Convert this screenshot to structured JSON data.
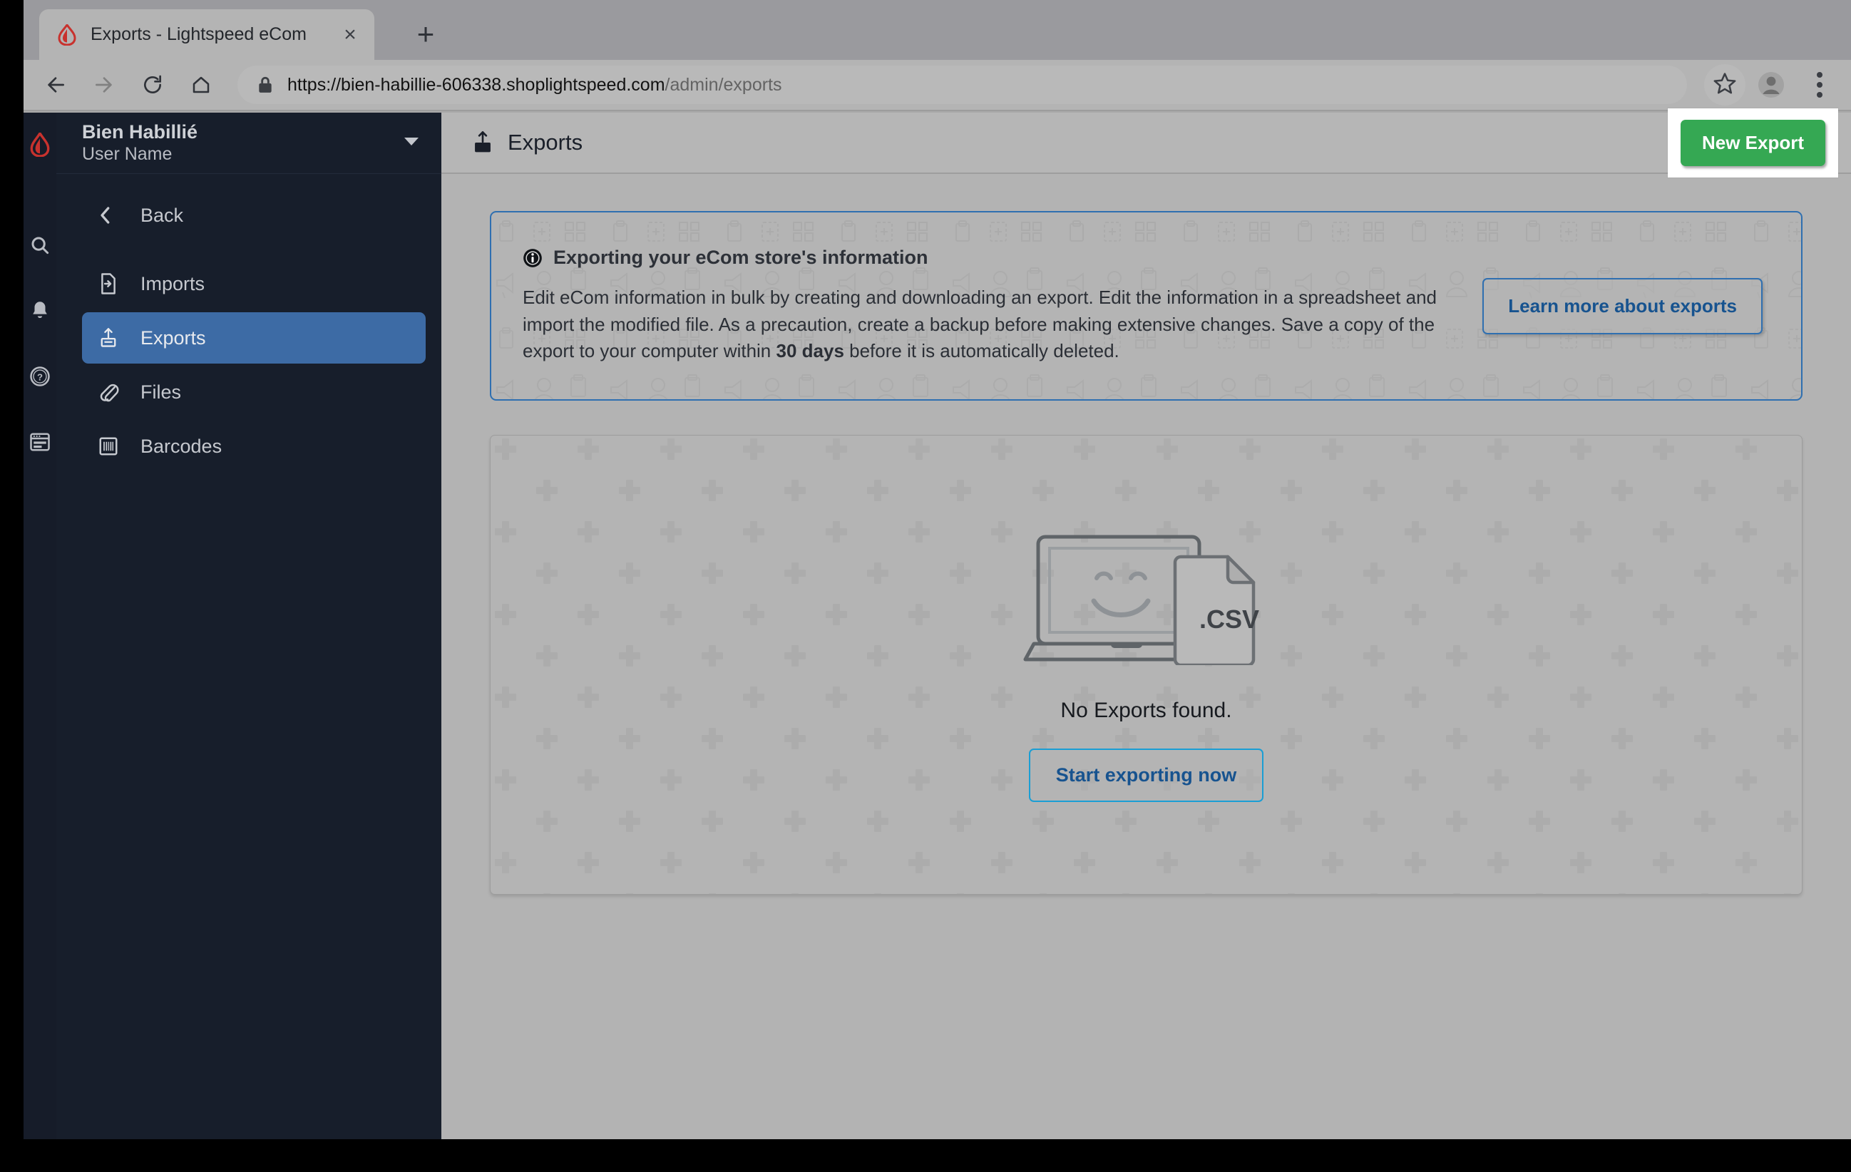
{
  "browser": {
    "tab": {
      "title": "Exports - Lightspeed eCom",
      "favicon": "lightspeed-flame-icon",
      "close": "×"
    },
    "new_tab_label": "+",
    "nav": {
      "back": "back-arrow-icon",
      "forward": "forward-arrow-icon",
      "reload": "reload-icon",
      "home": "home-icon"
    },
    "omnibox": {
      "lock": "lock-icon",
      "url_scheme_host": "https://bien-habillie-606338.shoplightspeed.com",
      "url_path": "/admin/exports",
      "full_url": "https://bien-habillie-606338.shoplightspeed.com/admin/exports"
    },
    "toolbar_icons": {
      "bookmark": "star-icon",
      "profile": "profile-avatar-icon",
      "menu": "three-dot-menu-icon"
    }
  },
  "sidebar": {
    "logo": "lightspeed-flame-logo",
    "rail_icons": [
      {
        "name": "search-icon"
      },
      {
        "name": "notifications-bell-icon"
      },
      {
        "name": "help-question-icon"
      },
      {
        "name": "browser-window-icon"
      }
    ],
    "account": {
      "shop_name": "Bien Habillié",
      "user_name": "User Name",
      "caret": "chevron-down-icon"
    },
    "back_label": "Back",
    "items": [
      {
        "label": "Imports",
        "icon": "import-file-icon",
        "active": false
      },
      {
        "label": "Exports",
        "icon": "export-upload-icon",
        "active": true
      },
      {
        "label": "Files",
        "icon": "paperclip-icon",
        "active": false
      },
      {
        "label": "Barcodes",
        "icon": "barcode-icon",
        "active": false
      }
    ]
  },
  "header": {
    "icon": "export-upload-icon",
    "title": "Exports",
    "new_export_label": "New Export"
  },
  "banner": {
    "icon": "info-circle-icon",
    "title": "Exporting your eCom store's information",
    "text_part1": "Edit eCom information in bulk by creating and downloading an export. Edit the information in a spreadsheet and import the modified file. As a precaution, create a backup before making extensive changes. Save a copy of the export to your computer within ",
    "text_bold": "30 days",
    "text_part2": " before it is automatically deleted.",
    "cta_label": "Learn more about exports"
  },
  "empty_state": {
    "illustration": "laptop-smiley-csv-illustration",
    "csv_label": ".CSV",
    "message": "No Exports found.",
    "cta_label": "Start exporting now"
  },
  "colors": {
    "accent_green": "#35a853",
    "accent_blue": "#2f6fb0",
    "link_blue": "#17538f",
    "sidebar_dark": "#171e2b",
    "sidebar_active": "#3d6ba5",
    "brand_red": "#c8322e"
  }
}
